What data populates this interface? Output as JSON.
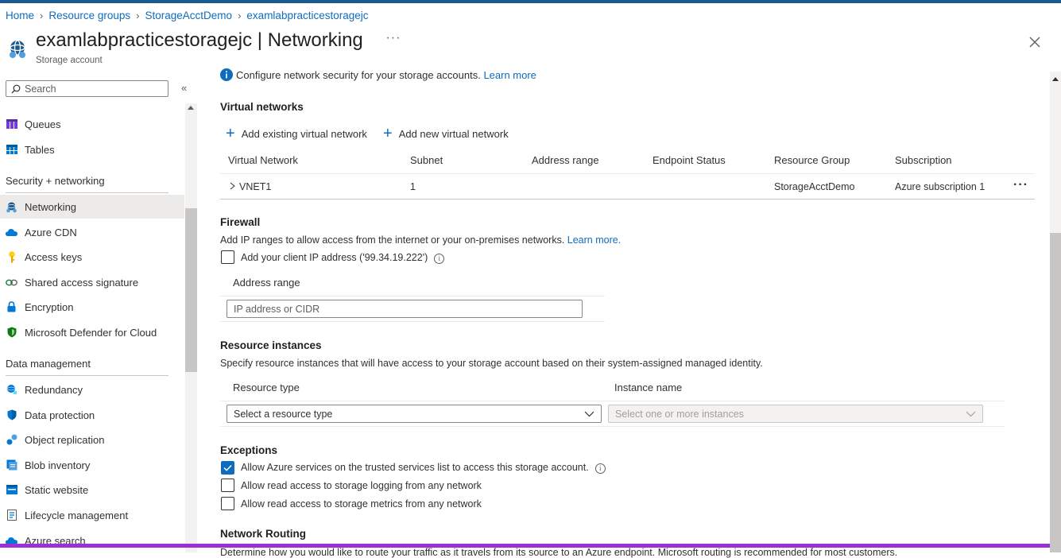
{
  "breadcrumb": [
    "Home",
    "Resource groups",
    "StorageAcctDemo",
    "examlabpracticestoragejc"
  ],
  "header": {
    "title_name": "examlabpracticestoragejc",
    "title_section": " | Networking",
    "more": "···",
    "subtitle": "Storage account"
  },
  "sidebar": {
    "search_placeholder": "Search",
    "collapse": "«",
    "items": [
      {
        "label": "Queues",
        "icon": "queues-icon"
      },
      {
        "label": "Tables",
        "icon": "tables-icon"
      },
      {
        "label": "Networking",
        "icon": "networking-icon",
        "active": true
      },
      {
        "label": "Azure CDN",
        "icon": "cloud-icon"
      },
      {
        "label": "Access keys",
        "icon": "key-icon"
      },
      {
        "label": "Shared access signature",
        "icon": "link-icon"
      },
      {
        "label": "Encryption",
        "icon": "lock-icon"
      },
      {
        "label": "Microsoft Defender for Cloud",
        "icon": "shield-icon"
      },
      {
        "label": "Redundancy",
        "icon": "globe-icon"
      },
      {
        "label": "Data protection",
        "icon": "shield-data-icon"
      },
      {
        "label": "Object replication",
        "icon": "replication-icon"
      },
      {
        "label": "Blob inventory",
        "icon": "inventory-icon"
      },
      {
        "label": "Static website",
        "icon": "website-icon"
      },
      {
        "label": "Lifecycle management",
        "icon": "lifecycle-icon"
      },
      {
        "label": "Azure search",
        "icon": "cloud-search-icon"
      }
    ],
    "groups": [
      "Security + networking",
      "Data management"
    ]
  },
  "main": {
    "info_text": "Configure network security for your storage accounts. ",
    "info_link": "Learn more",
    "vnet": {
      "title": "Virtual networks",
      "add_existing": "Add existing virtual network",
      "add_new": "Add new virtual network",
      "columns": [
        "Virtual Network",
        "Subnet",
        "Address range",
        "Endpoint Status",
        "Resource Group",
        "Subscription"
      ],
      "rows": [
        {
          "name": "VNET1",
          "subnet": "1",
          "address": "",
          "endpoint": "",
          "rg": "StorageAcctDemo",
          "subscription": "Azure subscription 1"
        }
      ]
    },
    "firewall": {
      "title": "Firewall",
      "desc": "Add IP ranges to allow access from the internet or your on-premises networks. ",
      "desc_link": "Learn more.",
      "client_ip_label": "Add your client IP address ('99.34.19.222')",
      "address_range_header": "Address range",
      "address_placeholder": "IP address or CIDR"
    },
    "resource_instances": {
      "title": "Resource instances",
      "desc": "Specify resource instances that will have access to your storage account based on their system-assigned managed identity.",
      "type_header": "Resource type",
      "name_header": "Instance name",
      "type_placeholder": "Select a resource type",
      "name_placeholder": "Select one or more instances"
    },
    "exceptions": {
      "title": "Exceptions",
      "items": [
        {
          "label": "Allow Azure services on the trusted services list to access this storage account.",
          "checked": true
        },
        {
          "label": "Allow read access to storage logging from any network",
          "checked": false
        },
        {
          "label": "Allow read access to storage metrics from any network",
          "checked": false
        }
      ]
    },
    "routing": {
      "title": "Network Routing",
      "desc": "Determine how you would like to route your traffic as it travels from its source to an Azure endpoint. Microsoft routing is recommended for most customers."
    }
  },
  "colors": {
    "accent": "#0f6cbd",
    "highlight_bar": "#9b30d9"
  }
}
